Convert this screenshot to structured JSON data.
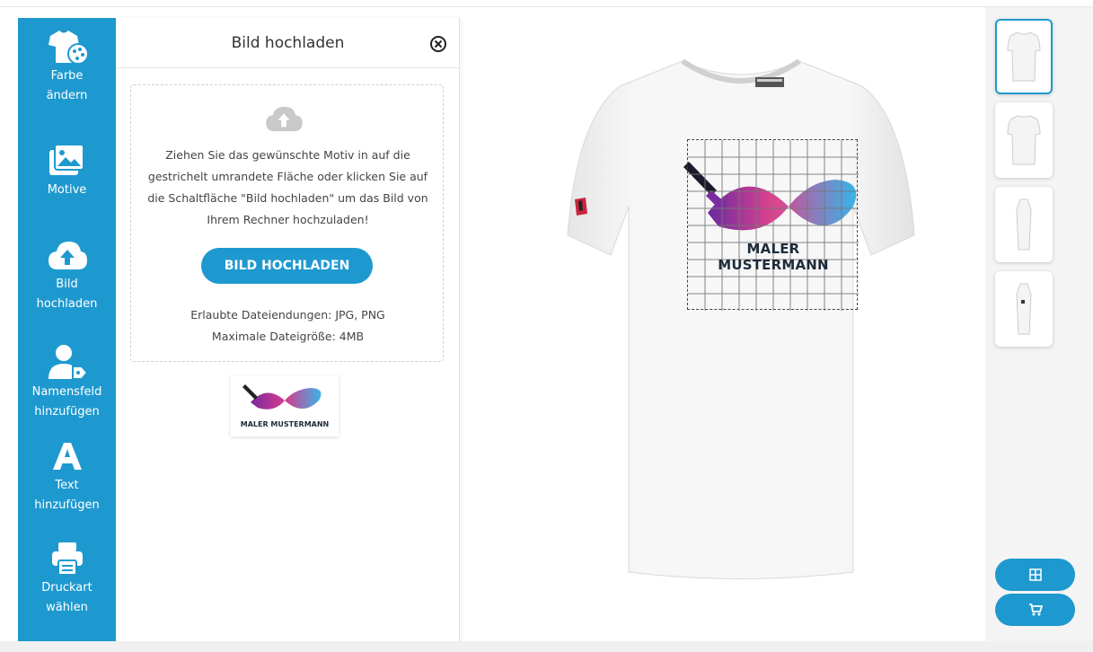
{
  "sidebar": {
    "items": [
      {
        "line1": "Farbe",
        "line2": "ändern",
        "icon": "tshirt-palette-icon"
      },
      {
        "line1": "Motive",
        "line2": "",
        "icon": "image-icon"
      },
      {
        "line1": "Bild",
        "line2": "hochladen",
        "icon": "cloud-upload-icon"
      },
      {
        "line1": "Namensfeld",
        "line2": "hinzufügen",
        "icon": "user-tag-icon"
      },
      {
        "line1": "Text",
        "line2": "hinzufügen",
        "icon": "letter-a-icon"
      },
      {
        "line1": "Druckart",
        "line2": "wählen",
        "icon": "printer-icon"
      }
    ],
    "color": "#1e99cf"
  },
  "panel": {
    "title": "Bild hochladen",
    "instructions": "Ziehen Sie das gewünschte Motiv in auf die gestrichelt umrandete Fläche oder klicken Sie auf die Schaltfläche \"Bild hochladen\" um das Bild von Ihrem Rechner hochzuladen!",
    "upload_button": "BILD HOCHLADEN",
    "allowed": "Erlaubte Dateiendungen: JPG, PNG",
    "max_size": "Maximale Dateigröße: 4MB",
    "uploaded_logo_text": "MALER MUSTERMANN"
  },
  "canvas": {
    "print_text": "MALER MUSTERMANN",
    "shirt_color": "#ffffff"
  },
  "views": [
    "front",
    "back",
    "left-side",
    "right-side"
  ],
  "actions": {
    "grid_icon": "grid-icon",
    "cart_icon": "cart-icon"
  }
}
